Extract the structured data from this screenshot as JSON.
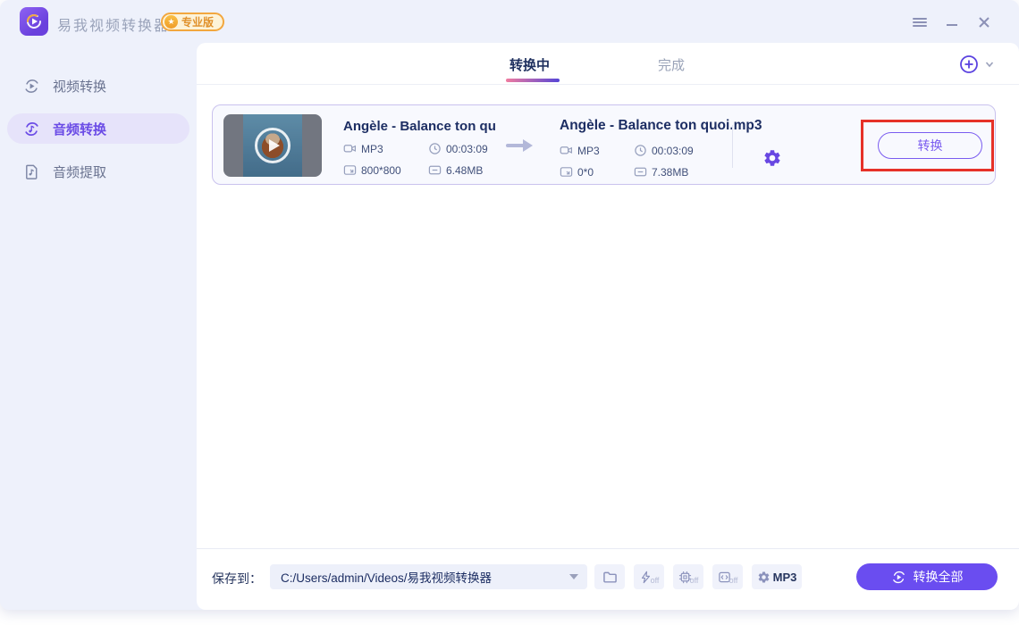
{
  "app": {
    "title": "易我视频转换器",
    "badge": "专业版"
  },
  "sidebar": {
    "items": [
      {
        "id": "video-convert",
        "label": "视频转换"
      },
      {
        "id": "audio-convert",
        "label": "音频转换"
      },
      {
        "id": "audio-extract",
        "label": "音频提取"
      }
    ]
  },
  "tabs": {
    "converting": "转换中",
    "done": "完成"
  },
  "task": {
    "source": {
      "name": "Angèle - Balance ton qu...",
      "format": "MP3",
      "duration": "00:03:09",
      "resolution": "800*800",
      "size": "6.48MB"
    },
    "target": {
      "name": "Angèle - Balance ton quoi.mp3",
      "format": "MP3",
      "duration": "00:03:09",
      "resolution": "0*0",
      "size": "7.38MB"
    },
    "convert_label": "转换"
  },
  "footer": {
    "save_label": "保存到：",
    "save_path": "C:/Users/admin/Videos/易我视频转换器",
    "toggle_off": "off",
    "format_label": "MP3",
    "convert_all_label": "转换全部"
  },
  "colors": {
    "accent": "#6b4ce6",
    "highlight": "#e63128",
    "badge": "#f2a73e"
  }
}
